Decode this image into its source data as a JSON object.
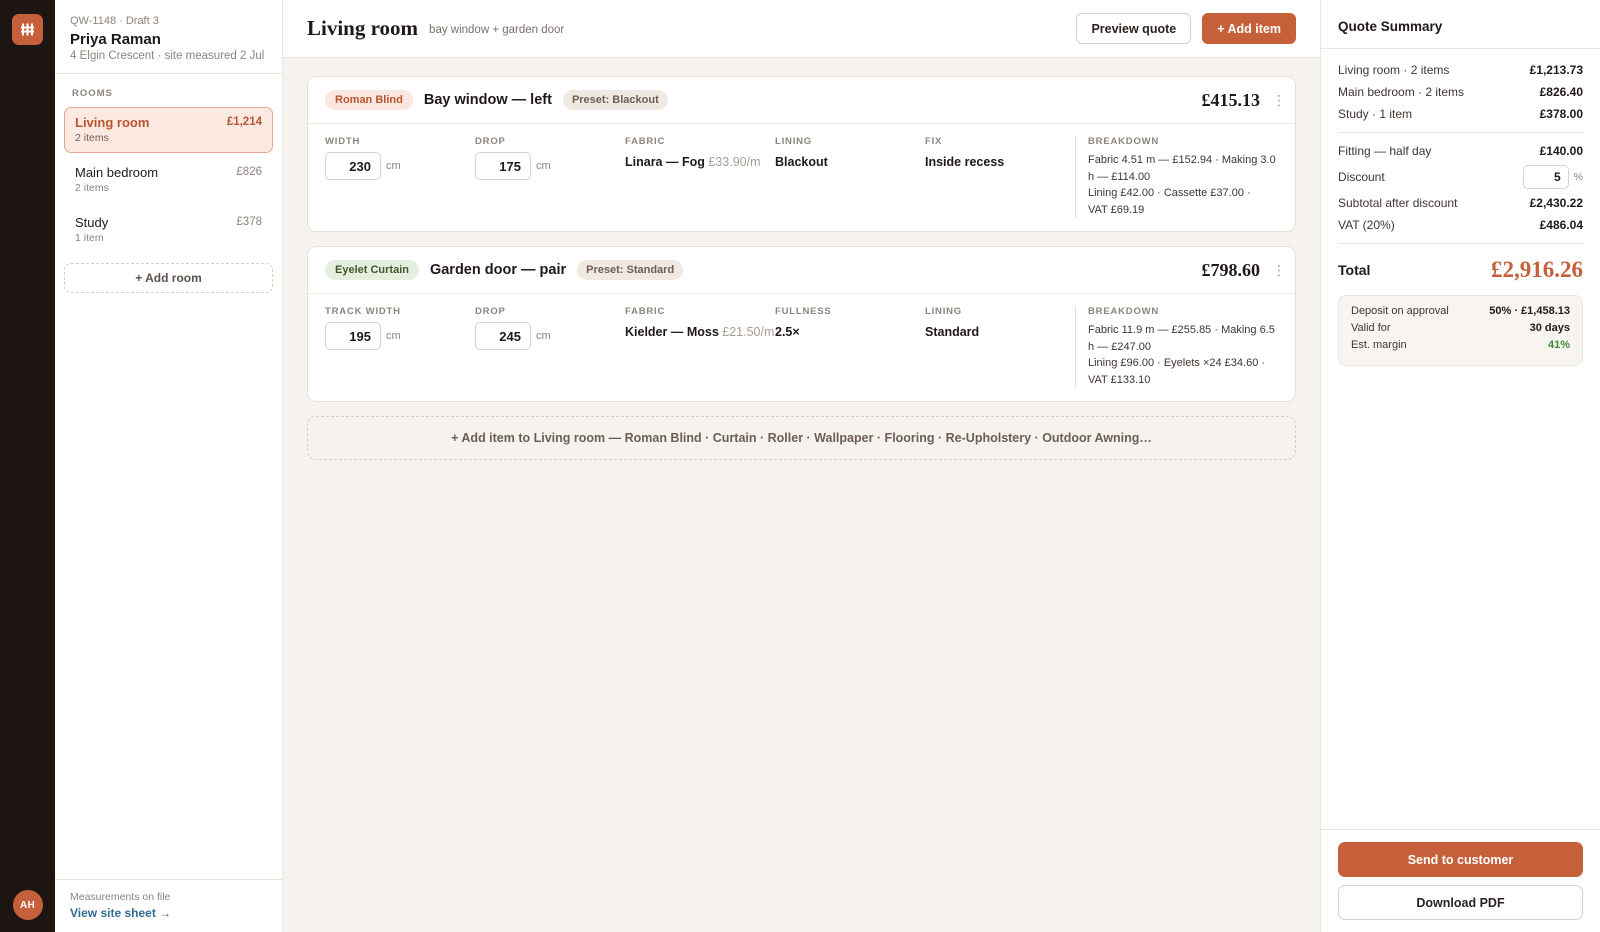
{
  "brand": {
    "logo_icon": "window-grid-icon",
    "accent": "#c6603a",
    "rail_bg": "#1c1512"
  },
  "user": {
    "initials": "AH"
  },
  "quote": {
    "ref": "QW-1148 · Draft 3",
    "customer_name": "Priya Raman",
    "address": "4 Elgin Crescent · site measured 2 Jul"
  },
  "rooms_label": "ROOMS",
  "rooms": [
    {
      "name": "Living room",
      "count": "2 items",
      "total": "£1,214"
    },
    {
      "name": "Main bedroom",
      "count": "2 items",
      "total": "£826"
    },
    {
      "name": "Study",
      "count": "1 item",
      "total": "£378"
    }
  ],
  "add_room_label": "+ Add room",
  "sidebar_footer": {
    "label": "Measurements on file",
    "link": "View site sheet →"
  },
  "header": {
    "title": "Living room",
    "subtitle": "bay window + garden door",
    "preview_label": "Preview quote",
    "add_item_label": "+ Add item"
  },
  "items": [
    {
      "type": "Roman Blind",
      "title": "Bay window — left",
      "preset": "Preset: Blackout",
      "price": "£415.13",
      "menu_icon": "more-vertical-icon",
      "width_label": "WIDTH",
      "width_value": "230",
      "width_unit": "cm",
      "drop_label": "DROP",
      "drop_value": "175",
      "drop_unit": "cm",
      "fabric_label": "FABRIC",
      "fabric_name": "Linara — Fog",
      "fabric_price": "£33.90/m",
      "f4_label": "LINING",
      "f4_value": "Blackout",
      "f5_label": "FIX",
      "f5_value": "Inside recess",
      "breakdown_label": "BREAKDOWN",
      "breakdown": [
        "Fabric 4.51 m — £152.94 · Making 3.0",
        "h — £114.00",
        "Lining £42.00 · Cassette £37.00 ·",
        "VAT £69.19"
      ]
    },
    {
      "type": "Eyelet Curtain",
      "title": "Garden door — pair",
      "preset": "Preset: Standard",
      "price": "£798.60",
      "menu_icon": "more-vertical-icon",
      "width_label": "TRACK WIDTH",
      "width_value": "195",
      "width_unit": "cm",
      "drop_label": "DROP",
      "drop_value": "245",
      "drop_unit": "cm",
      "fabric_label": "FABRIC",
      "fabric_name": "Kielder — Moss",
      "fabric_price": "£21.50/m",
      "f4_label": "FULLNESS",
      "f4_value": "2.5×",
      "f5_label": "LINING",
      "f5_value": "Standard",
      "breakdown_label": "BREAKDOWN",
      "breakdown": [
        "Fabric 11.9 m — £255.85 · Making 6.5",
        "h — £247.00",
        "Lining £96.00 · Eyelets ×24 £34.60 ·",
        "VAT £133.10"
      ]
    }
  ],
  "add_item_bar": "+ Add item to Living room — Roman Blind · Curtain · Roller · Wallpaper · Flooring · Re-Upholstery · Outdoor Awning…",
  "summary": {
    "title": "Quote Summary",
    "rooms": [
      {
        "label": "Living room · 2 items",
        "value": "£1,213.73"
      },
      {
        "label": "Main bedroom · 2 items",
        "value": "£826.40"
      },
      {
        "label": "Study · 1 item",
        "value": "£378.00"
      }
    ],
    "fitting_label": "Fitting — half day",
    "fitting_value": "£140.00",
    "discount_label": "Discount",
    "discount_value": "5",
    "discount_unit": "%",
    "subtotal_label": "Subtotal after discount",
    "subtotal_value": "£2,430.22",
    "vat_label": "VAT (20%)",
    "vat_value": "£486.04",
    "total_label": "Total",
    "total_value": "£2,916.26",
    "deposit_label": "Deposit on approval",
    "deposit_value": "50% · £1,458.13",
    "valid_label": "Valid for",
    "valid_value": "30 days",
    "margin_label": "Est. margin",
    "margin_value": "41%",
    "send_label": "Send to customer",
    "download_label": "Download PDF"
  }
}
